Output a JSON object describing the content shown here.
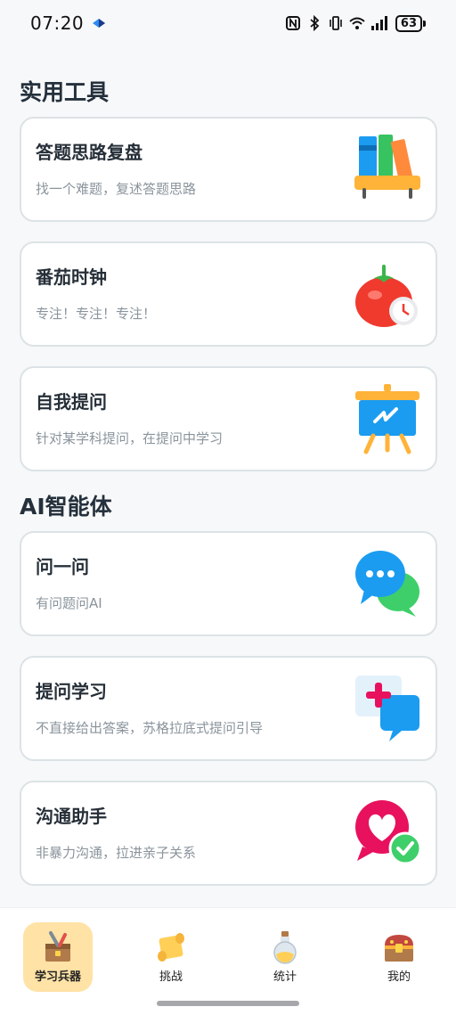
{
  "status": {
    "time": "07:20",
    "battery": "63",
    "icons": [
      "nfc-icon",
      "bluetooth-icon",
      "vibrate-icon",
      "wifi-icon",
      "signal-icon"
    ]
  },
  "sections": {
    "tools_title": "实用工具",
    "ai_title": "AI智能体"
  },
  "tools": [
    {
      "title": "答题思路复盘",
      "subtitle": "找一个难题，复述答题思路",
      "icon": "books-shelf-icon"
    },
    {
      "title": "番茄时钟",
      "subtitle": "专注！专注！专注！",
      "icon": "tomato-clock-icon"
    },
    {
      "title": "自我提问",
      "subtitle": "针对某学科提问，在提问中学习",
      "icon": "easel-board-icon"
    }
  ],
  "agents": [
    {
      "title": "问一问",
      "subtitle": "有问题问AI",
      "icon": "chat-bubbles-icon"
    },
    {
      "title": "提问学习",
      "subtitle": "不直接给出答案，苏格拉底式提问引导",
      "icon": "question-cards-icon"
    },
    {
      "title": "沟通助手",
      "subtitle": "非暴力沟通，拉进亲子关系",
      "icon": "heart-check-icon"
    }
  ],
  "nav": [
    {
      "label": "学习兵器",
      "icon": "weapon-box-icon",
      "active": true
    },
    {
      "label": "挑战",
      "icon": "scroll-icon",
      "active": false
    },
    {
      "label": "统计",
      "icon": "potion-bottle-icon",
      "active": false
    },
    {
      "label": "我的",
      "icon": "treasure-chest-icon",
      "active": false
    }
  ],
  "colors": {
    "active_nav_bg": "#ffe2a6",
    "card_border": "#dce3e6",
    "page_bg": "#f7f8f9"
  }
}
